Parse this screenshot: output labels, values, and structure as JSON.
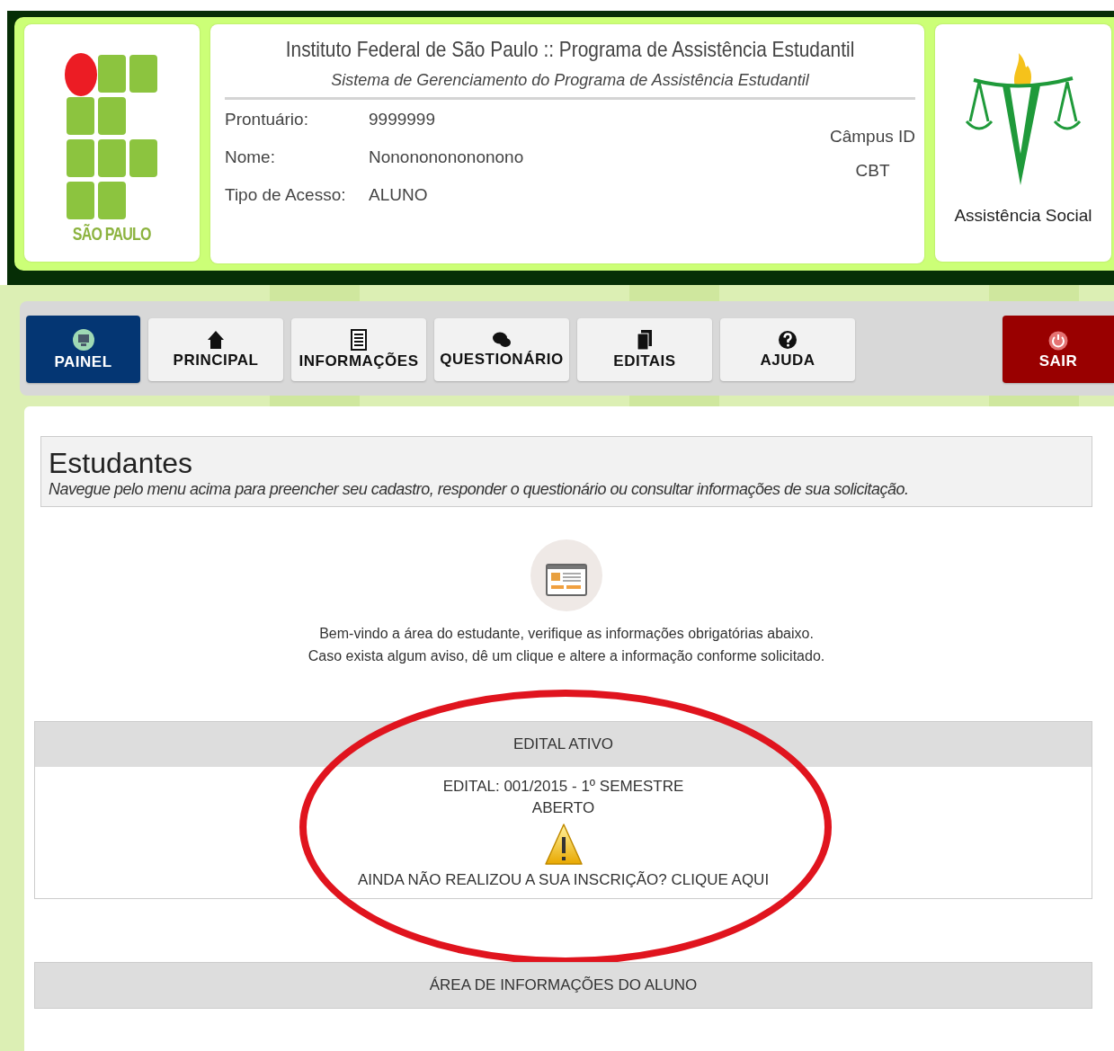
{
  "header": {
    "logo_text": "SÃO PAULO",
    "title": "Instituto Federal de São Paulo :: Programa de Assistência Estudantil",
    "subtitle": "Sistema de Gerenciamento do Programa de Assistência Estudantil",
    "fields": [
      {
        "label": "Prontuário:",
        "value": "9999999"
      },
      {
        "label": "Nome:",
        "value": "Nononononononono"
      },
      {
        "label": "Tipo de Acesso:",
        "value": "ALUNO"
      }
    ],
    "campus_label": "Câmpus ID",
    "campus_value": "CBT",
    "badge_text": "Assistência Social"
  },
  "nav": [
    {
      "label": "PAINEL",
      "selected": true
    },
    {
      "label": "PRINCIPAL",
      "selected": false
    },
    {
      "label": "INFORMAÇÕES",
      "selected": false
    },
    {
      "label": "QUESTIONÁRIO",
      "selected": false
    },
    {
      "label": "EDITAIS",
      "selected": false
    },
    {
      "label": "AJUDA",
      "selected": false
    }
  ],
  "logout": {
    "label": "SAIR"
  },
  "page": {
    "title": "Estudantes",
    "description": "Navegue pelo menu acima para preencher seu cadastro, responder o questionário ou consultar informações de sua solicitação.",
    "welcome": [
      "Bem-vindo a área do estudante, verifique as informações obrigatórias abaixo.",
      "Caso exista algum aviso, dê um clique e altere a informação conforme solicitado."
    ]
  },
  "edital": {
    "heading": "EDITAL ATIVO",
    "name": "EDITAL: 001/2015 - 1º SEMESTRE",
    "status": "ABERTO",
    "link": "AINDA NÃO REALIZOU A SUA INSCRIÇÃO? CLIQUE AQUI",
    "highlighted": true
  },
  "info": {
    "heading": "ÁREA DE INFORMAÇÕES DO ALUNO"
  }
}
